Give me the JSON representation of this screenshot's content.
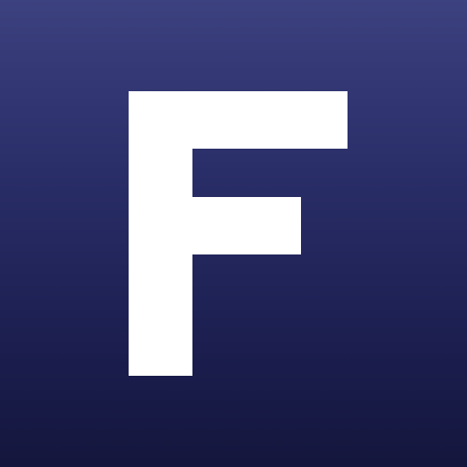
{
  "app_icon": {
    "letter": "F",
    "icon": "letter-f-logo-icon",
    "colors": {
      "background_top": "#3c417f",
      "background_bottom": "#14163d",
      "letter": "#ffffff"
    }
  }
}
